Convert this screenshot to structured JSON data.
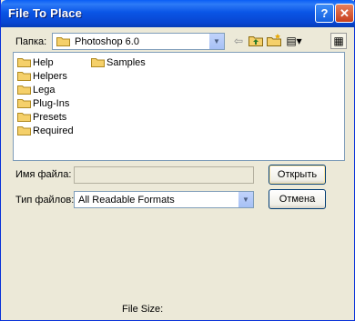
{
  "window": {
    "title": "File To Place"
  },
  "titlebar": {
    "help_glyph": "?",
    "close_glyph": "✕"
  },
  "lookin": {
    "label": "Папка:",
    "value": "Photoshop 6.0"
  },
  "toolbar": {
    "back_glyph": "⇦",
    "up_glyph": "▲",
    "new_glyph": "✱",
    "view_glyph": "▤▾",
    "extra_glyph": "▦"
  },
  "files": [
    {
      "name": "Help"
    },
    {
      "name": "Helpers"
    },
    {
      "name": "Lega"
    },
    {
      "name": "Plug-Ins"
    },
    {
      "name": "Presets"
    },
    {
      "name": "Required"
    },
    {
      "name": "Samples"
    }
  ],
  "filename": {
    "label": "Имя файла:",
    "value": ""
  },
  "filetype": {
    "label": "Тип файлов:",
    "value": "All Readable Formats"
  },
  "buttons": {
    "open": "Открыть",
    "cancel": "Отмена"
  },
  "status": {
    "file_size_label": "File Size:"
  },
  "colors": {
    "title_blue": "#0a55e6",
    "folder_yellow": "#f5d06a",
    "face": "#ece9d8"
  }
}
